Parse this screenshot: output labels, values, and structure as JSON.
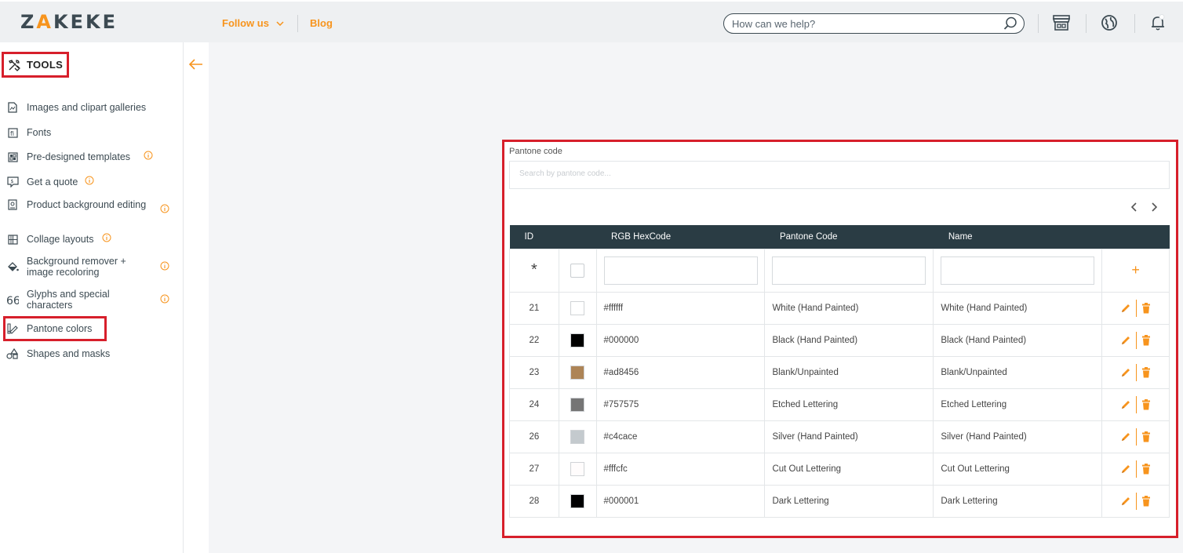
{
  "topbar": {
    "logo": "ZAKEKE",
    "follow_us": "Follow us",
    "blog": "Blog",
    "search_placeholder": "How can we help?"
  },
  "sidebar": {
    "header": "TOOLS",
    "items": [
      {
        "label": "Images and clipart galleries",
        "info": false
      },
      {
        "label": "Fonts",
        "info": false
      },
      {
        "label": "Pre-designed templates",
        "info": true
      },
      {
        "label": "Get a quote",
        "info": true
      },
      {
        "label": "Product background editing",
        "info": true
      },
      {
        "label": "Collage layouts",
        "info": true
      },
      {
        "label": "Background remover + image recoloring",
        "info": true
      },
      {
        "label": "Glyphs and special characters",
        "info": true
      },
      {
        "label": "Pantone colors",
        "info": false
      },
      {
        "label": "Shapes and masks",
        "info": false
      }
    ]
  },
  "panel": {
    "search_label": "Pantone code",
    "search_placeholder": "Search by pantone code...",
    "columns": [
      "ID",
      "RGB HexCode",
      "Pantone Code",
      "Name"
    ],
    "new_row_marker": "*",
    "add_symbol": "+",
    "rows": [
      {
        "id": "21",
        "hex": "#ffffff",
        "pantone": "White (Hand Painted)",
        "name": "White (Hand Painted)",
        "swatch": "#ffffff"
      },
      {
        "id": "22",
        "hex": "#000000",
        "pantone": "Black (Hand Painted)",
        "name": "Black (Hand Painted)",
        "swatch": "#000000"
      },
      {
        "id": "23",
        "hex": "#ad8456",
        "pantone": "Blank/Unpainted",
        "name": "Blank/Unpainted",
        "swatch": "#ad8456"
      },
      {
        "id": "24",
        "hex": "#757575",
        "pantone": "Etched Lettering",
        "name": "Etched Lettering",
        "swatch": "#757575"
      },
      {
        "id": "26",
        "hex": "#c4cace",
        "pantone": "Silver (Hand Painted)",
        "name": "Silver (Hand Painted)",
        "swatch": "#c4cace"
      },
      {
        "id": "27",
        "hex": "#fffcfc",
        "pantone": "Cut Out Lettering",
        "name": "Cut Out Lettering",
        "swatch": "#fffcfc"
      },
      {
        "id": "28",
        "hex": "#000001",
        "pantone": "Dark Lettering",
        "name": "Dark Lettering",
        "swatch": "#000001"
      }
    ]
  },
  "colors": {
    "accent": "#f7941d",
    "header_bg": "#2a3c44",
    "highlight": "#d71f2b"
  }
}
